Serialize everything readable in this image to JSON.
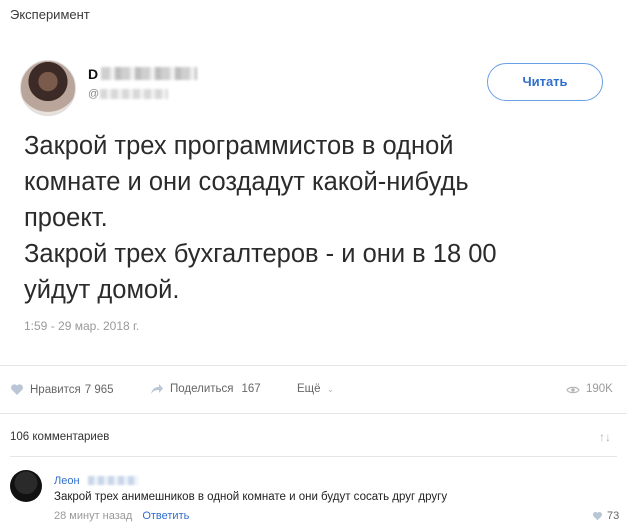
{
  "post": {
    "title": "Эксперимент"
  },
  "tweet": {
    "author_name_visible": "D",
    "author_handle_visible": "@",
    "follow_label": "Читать",
    "lines": [
      "Закрой трех программистов в одной",
      "комнате и они создадут какой-нибудь",
      "проект.",
      "Закрой трех бухгалтеров - и они в 18 00",
      "уйдут домой."
    ],
    "timestamp": "1:59 - 29 мар. 2018 г."
  },
  "actions": {
    "like_label": "Нравится",
    "like_count": "7 965",
    "share_label": "Поделиться",
    "share_count": "167",
    "more_label": "Ещё",
    "views": "190K"
  },
  "comments": {
    "header": "106 комментариев",
    "items": [
      {
        "author_visible": "Леон",
        "text": "Закрой трех анимешников в одной комнате и они будут сосать друг другу",
        "time": "28 минут назад",
        "reply_label": "Ответить",
        "likes": "73"
      }
    ]
  },
  "colors": {
    "accent": "#2f6fcb",
    "muted": "#9a9a9a"
  }
}
